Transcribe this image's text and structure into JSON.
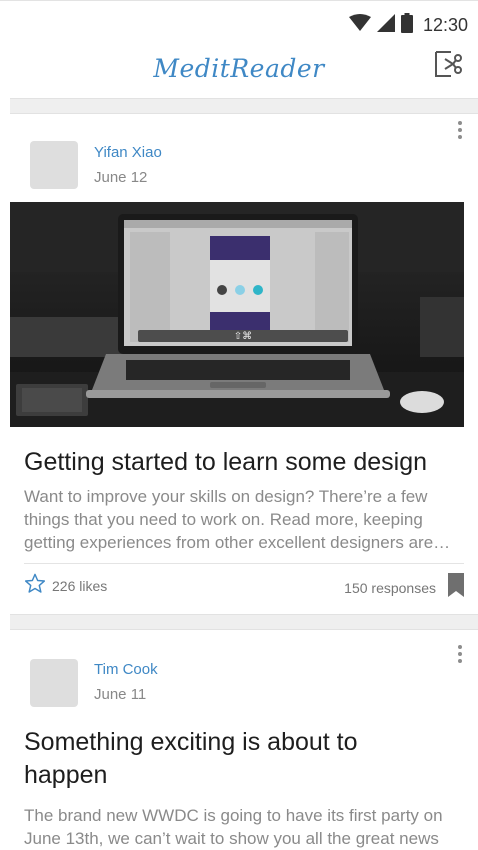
{
  "status": {
    "time": "12:30"
  },
  "app": {
    "title": "MeditReader"
  },
  "posts": [
    {
      "author": "Yifan Xiao",
      "date": "June 12",
      "title": "Getting started to learn some design",
      "excerpt": "Want to improve your skills on design? There’re a few things that you need to work on. Read more, keeping getting experiences from other excellent designers are…",
      "likes_label": "226 likes",
      "responses_label": "150 responses"
    },
    {
      "author": "Tim Cook",
      "date": "June 11",
      "title": "Something exciting is about to happen",
      "excerpt": "The brand new WWDC is going to have its first party on June 13th, we can’t wait to show you all the great news"
    }
  ],
  "colors": {
    "accent": "#3f88c5",
    "text_dark": "#1e1e1e",
    "text_muted": "#8a8a8a"
  },
  "icons": [
    "wifi-icon",
    "cell-signal-icon",
    "battery-icon",
    "share-icon",
    "more-vertical-icon",
    "star-outline-icon",
    "bookmark-icon"
  ]
}
